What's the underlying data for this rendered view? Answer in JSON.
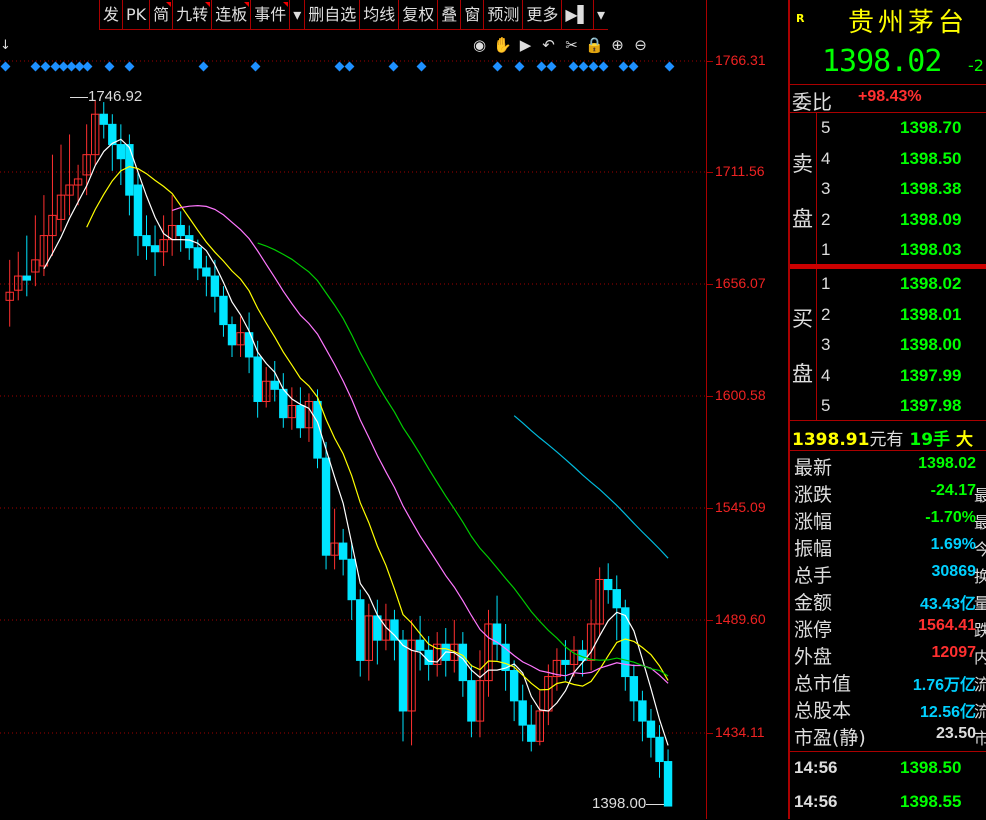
{
  "toolbar": {
    "items": [
      {
        "label": "发",
        "mark": false
      },
      {
        "label": "PK",
        "mark": false
      },
      {
        "label": "简",
        "mark": true
      },
      {
        "label": "九转",
        "mark": true
      },
      {
        "label": "连板",
        "mark": true
      },
      {
        "label": "事件",
        "mark": true
      },
      {
        "label": "▾",
        "mark": false
      },
      {
        "label": "删自选",
        "mark": false
      },
      {
        "label": "均线",
        "mark": false
      },
      {
        "label": "复权",
        "mark": false
      },
      {
        "label": "叠",
        "mark": false
      },
      {
        "label": "窗",
        "mark": false
      },
      {
        "label": "预测",
        "mark": false
      },
      {
        "label": "更多",
        "mark": false
      },
      {
        "label": "▶▌",
        "mark": false
      },
      {
        "label": "▾",
        "mark": false
      }
    ],
    "tools": [
      "eye-icon",
      "hand-icon",
      "play-icon",
      "undo-icon",
      "scissors-icon",
      "lock-icon",
      "zoom-in-icon",
      "zoom-out-icon"
    ]
  },
  "chart": {
    "high_label": "1746.92",
    "low_label": "1398.00",
    "axis_labels": [
      "1766.31",
      "1711.56",
      "1656.07",
      "1600.58",
      "1545.09",
      "1489.60",
      "1434.11"
    ],
    "colors": {
      "up": "#ff3030",
      "down": "#00e5ff",
      "ma5": "#ffffff",
      "ma10": "#ffff00",
      "ma20": "#ff77ff",
      "ma30": "#00cc00",
      "ma60": "#00bbdd",
      "axis": "#ff2222",
      "grid": "#a00000"
    }
  },
  "quote": {
    "badge": "R",
    "name": "贵州茅台",
    "price": "1398.02",
    "change_partial": "-2",
    "ratio_label": "委比",
    "ratio_value": "+98.43%",
    "sell_label": [
      "卖",
      "盘"
    ],
    "buy_label": [
      "买",
      "盘"
    ],
    "asks": [
      {
        "level": "5",
        "price": "1398.70"
      },
      {
        "level": "4",
        "price": "1398.50"
      },
      {
        "level": "3",
        "price": "1398.38"
      },
      {
        "level": "2",
        "price": "1398.09"
      },
      {
        "level": "1",
        "price": "1398.03"
      }
    ],
    "bids": [
      {
        "level": "1",
        "price": "1398.02"
      },
      {
        "level": "2",
        "price": "1398.01"
      },
      {
        "level": "3",
        "price": "1398.00"
      },
      {
        "level": "4",
        "price": "1397.99"
      },
      {
        "level": "5",
        "price": "1397.98"
      }
    ],
    "ticker_line": "1398.91元有 19手 大",
    "stats": [
      {
        "label": "最新",
        "value": "1398.02",
        "color": "#00ff00",
        "tail": ""
      },
      {
        "label": "涨跌",
        "value": "-24.17",
        "color": "#00ff00",
        "tail": "最"
      },
      {
        "label": "涨幅",
        "value": "-1.70%",
        "color": "#00ff00",
        "tail": "最"
      },
      {
        "label": "振幅",
        "value": "1.69%",
        "color": "#00d0ff",
        "tail": "今"
      },
      {
        "label": "总手",
        "value": "30869",
        "color": "#00d0ff",
        "tail": "换"
      },
      {
        "label": "金额",
        "value": "43.43亿",
        "color": "#00d0ff",
        "tail": "量"
      },
      {
        "label": "涨停",
        "value": "1564.41",
        "color": "#ff3030",
        "tail": "跌"
      },
      {
        "label": "外盘",
        "value": "12097",
        "color": "#ff3030",
        "tail": "内"
      },
      {
        "label": "总市值",
        "value": "1.76万亿",
        "color": "#00d0ff",
        "tail": "流"
      },
      {
        "label": "总股本",
        "value": "12.56亿",
        "color": "#00d0ff",
        "tail": "流"
      },
      {
        "label": "市盈(静)",
        "value": "23.50",
        "color": "#dddddd",
        "tail": "市"
      }
    ],
    "ticks": [
      {
        "time": "14:56",
        "price": "1398.50"
      },
      {
        "time": "14:56",
        "price": "1398.55"
      }
    ]
  }
}
